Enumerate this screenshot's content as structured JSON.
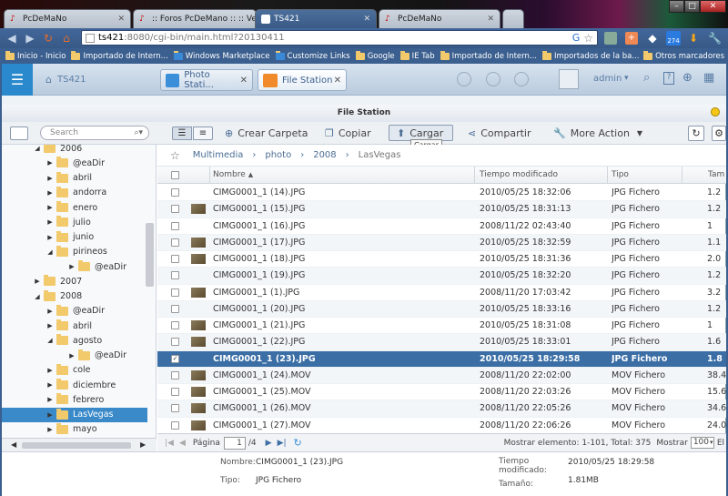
{
  "browser": {
    "tabs": [
      {
        "label": "PcDeMaNo",
        "active": false
      },
      {
        "label": ":: Foros PcDeMano :: :: Ve",
        "active": false
      },
      {
        "label": "TS421",
        "active": true
      },
      {
        "label": "PcDeMaNo",
        "active": false
      }
    ],
    "url_host": "ts421",
    "url_rest": ":8080/cgi-bin/main.html?20130411",
    "bookmarks": [
      "Inicio - Inicio",
      "Importado de Intern...",
      "Windows Marketplace",
      "Customize Links",
      "Google",
      "IE Tab",
      "Importado de Intern...",
      "Importados de la ba...",
      "Otros marcadores"
    ],
    "badge_count": "274"
  },
  "app": {
    "nas_name": "TS421",
    "tabs": [
      {
        "label": "Photo Stati...",
        "active": false
      },
      {
        "label": "File Station",
        "active": true
      }
    ],
    "user": "admin"
  },
  "fs": {
    "title": "File Station",
    "search_placeholder": "Search",
    "toolbar": {
      "create": "Crear Carpeta",
      "copy": "Copiar",
      "upload": "Cargar",
      "share": "Compartir",
      "more": "More Action"
    },
    "tooltip": "Cargar",
    "breadcrumb": [
      "Multimedia",
      "photo",
      "2008",
      "LasVegas"
    ],
    "tree": [
      {
        "label": "2006",
        "level": 1,
        "expanded": true
      },
      {
        "label": "@eaDir",
        "level": 2,
        "expanded": false
      },
      {
        "label": "abril",
        "level": 2,
        "expanded": false
      },
      {
        "label": "andorra",
        "level": 2,
        "expanded": false
      },
      {
        "label": "enero",
        "level": 2,
        "expanded": false
      },
      {
        "label": "julio",
        "level": 2,
        "expanded": false
      },
      {
        "label": "junio",
        "level": 2,
        "expanded": false
      },
      {
        "label": "pirineos",
        "level": 2,
        "expanded": true
      },
      {
        "label": "@eaDir",
        "level": 3,
        "expanded": false
      },
      {
        "label": "2007",
        "level": 1,
        "expanded": false
      },
      {
        "label": "2008",
        "level": 1,
        "expanded": true
      },
      {
        "label": "@eaDir",
        "level": 2,
        "expanded": false
      },
      {
        "label": "abril",
        "level": 2,
        "expanded": false
      },
      {
        "label": "agosto",
        "level": 2,
        "expanded": true
      },
      {
        "label": "@eaDir",
        "level": 3,
        "expanded": false
      },
      {
        "label": "cole",
        "level": 2,
        "expanded": false
      },
      {
        "label": "diciembre",
        "level": 2,
        "expanded": false
      },
      {
        "label": "febrero",
        "level": 2,
        "expanded": false
      },
      {
        "label": "LasVegas",
        "level": 2,
        "expanded": false,
        "selected": true
      },
      {
        "label": "mayo",
        "level": 2,
        "expanded": false
      }
    ],
    "columns": {
      "name": "Nombre",
      "modified": "Tiempo modificado",
      "type": "Tipo",
      "size": "Tam"
    },
    "rows": [
      {
        "name": "CIMG0001_1 (14).JPG",
        "modified": "2010/05/25 18:32:06",
        "type": "JPG Fichero",
        "size": "1.2",
        "thumb": false
      },
      {
        "name": "CIMG0001_1 (15).JPG",
        "modified": "2010/05/25 18:31:13",
        "type": "JPG Fichero",
        "size": "1.2",
        "thumb": true
      },
      {
        "name": "CIMG0001_1 (16).JPG",
        "modified": "2008/11/22 02:43:40",
        "type": "JPG Fichero",
        "size": "1",
        "thumb": false
      },
      {
        "name": "CIMG0001_1 (17).JPG",
        "modified": "2010/05/25 18:32:59",
        "type": "JPG Fichero",
        "size": "1.1",
        "thumb": true
      },
      {
        "name": "CIMG0001_1 (18).JPG",
        "modified": "2010/05/25 18:31:36",
        "type": "JPG Fichero",
        "size": "2.0",
        "thumb": true
      },
      {
        "name": "CIMG0001_1 (19).JPG",
        "modified": "2010/05/25 18:32:20",
        "type": "JPG Fichero",
        "size": "1.2",
        "thumb": false
      },
      {
        "name": "CIMG0001_1 (1).JPG",
        "modified": "2008/11/20 17:03:42",
        "type": "JPG Fichero",
        "size": "3.2",
        "thumb": true
      },
      {
        "name": "CIMG0001_1 (20).JPG",
        "modified": "2010/05/25 18:33:16",
        "type": "JPG Fichero",
        "size": "1.2",
        "thumb": false
      },
      {
        "name": "CIMG0001_1 (21).JPG",
        "modified": "2010/05/25 18:31:08",
        "type": "JPG Fichero",
        "size": "1",
        "thumb": true
      },
      {
        "name": "CIMG0001_1 (22).JPG",
        "modified": "2010/05/25 18:33:01",
        "type": "JPG Fichero",
        "size": "1.6",
        "thumb": true
      },
      {
        "name": "CIMG0001_1 (23).JPG",
        "modified": "2010/05/25 18:29:58",
        "type": "JPG Fichero",
        "size": "1.8",
        "thumb": false,
        "selected": true
      },
      {
        "name": "CIMG0001_1 (24).MOV",
        "modified": "2008/11/20 22:02:00",
        "type": "MOV Fichero",
        "size": "38.4",
        "thumb": true
      },
      {
        "name": "CIMG0001_1 (25).MOV",
        "modified": "2008/11/20 22:03:26",
        "type": "MOV Fichero",
        "size": "15.6",
        "thumb": true
      },
      {
        "name": "CIMG0001_1 (26).MOV",
        "modified": "2008/11/20 22:05:26",
        "type": "MOV Fichero",
        "size": "34.6",
        "thumb": true
      },
      {
        "name": "CIMG0001_1 (27).MOV",
        "modified": "2008/11/20 22:06:26",
        "type": "MOV Fichero",
        "size": "24.0",
        "thumb": true
      }
    ],
    "pager": {
      "page_label": "Página",
      "page": "1",
      "of": "/4",
      "showing": "Mostrar elemento: 1-101, Total: 375",
      "show_label": "Mostrar",
      "per_page": "100",
      "trail": "El"
    },
    "details": {
      "name_label": "Nombre:",
      "name_value": "CIMG0001_1 (23).JPG",
      "type_label": "Tipo:",
      "type_value": "JPG Fichero",
      "mod_label": "Tiempo modificado:",
      "mod_value": "2010/05/25 18:29:58",
      "size_label": "Tamaño:",
      "size_value": "1.81MB"
    }
  }
}
